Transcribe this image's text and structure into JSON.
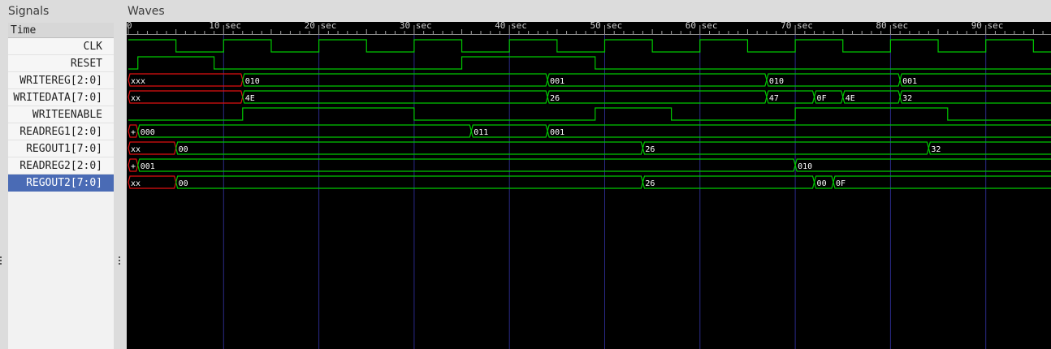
{
  "signals_panel": {
    "title": "Signals",
    "time_header": "Time",
    "signals": [
      {
        "label": "CLK",
        "selected": false
      },
      {
        "label": "RESET",
        "selected": false
      },
      {
        "label": "WRITEREG[2:0]",
        "selected": false
      },
      {
        "label": "WRITEDATA[7:0]",
        "selected": false
      },
      {
        "label": "WRITEENABLE",
        "selected": false
      },
      {
        "label": "READREG1[2:0]",
        "selected": false
      },
      {
        "label": "REGOUT1[7:0]",
        "selected": false
      },
      {
        "label": "READREG2[2:0]",
        "selected": false
      },
      {
        "label": "REGOUT2[7:0]",
        "selected": true
      }
    ]
  },
  "waves_panel": {
    "title": "Waves",
    "time_axis": {
      "unit": "sec",
      "tick_labels": [
        "0",
        "10 sec",
        "20 sec",
        "30 sec",
        "40 sec",
        "50 sec",
        "60 sec",
        "70 sec",
        "80 sec",
        "90 sec"
      ],
      "major_ticks_sec": [
        0,
        10,
        20,
        30,
        40,
        50,
        60,
        70,
        80,
        90
      ],
      "visible_end_sec": 96.3
    },
    "colors": {
      "background": "#000000",
      "trace": "#00c800",
      "unknown": "#e01010",
      "grid": "#2a2a88",
      "text": "#ffffff"
    },
    "traces": [
      {
        "name": "CLK",
        "kind": "bit",
        "changes": [
          [
            0,
            1
          ],
          [
            5,
            0
          ],
          [
            10,
            1
          ],
          [
            15,
            0
          ],
          [
            20,
            1
          ],
          [
            25,
            0
          ],
          [
            30,
            1
          ],
          [
            35,
            0
          ],
          [
            40,
            1
          ],
          [
            45,
            0
          ],
          [
            50,
            1
          ],
          [
            55,
            0
          ],
          [
            60,
            1
          ],
          [
            65,
            0
          ],
          [
            70,
            1
          ],
          [
            75,
            0
          ],
          [
            80,
            1
          ],
          [
            85,
            0
          ],
          [
            90,
            1
          ],
          [
            95,
            0
          ]
        ]
      },
      {
        "name": "RESET",
        "kind": "bit",
        "changes": [
          [
            0,
            0
          ],
          [
            1,
            1
          ],
          [
            9,
            0
          ],
          [
            35,
            1
          ],
          [
            49,
            0
          ]
        ]
      },
      {
        "name": "WRITEREG[2:0]",
        "kind": "bus",
        "segments": [
          [
            0,
            12,
            "xxx",
            true
          ],
          [
            12,
            44,
            "010",
            false
          ],
          [
            44,
            67,
            "001",
            false
          ],
          [
            67,
            81,
            "010",
            false
          ],
          [
            81,
            null,
            "001",
            false
          ]
        ]
      },
      {
        "name": "WRITEDATA[7:0]",
        "kind": "bus",
        "segments": [
          [
            0,
            12,
            "xx",
            true
          ],
          [
            12,
            44,
            "4E",
            false
          ],
          [
            44,
            67,
            "26",
            false
          ],
          [
            67,
            72,
            "47",
            false
          ],
          [
            72,
            75,
            "0F",
            false
          ],
          [
            75,
            81,
            "4E",
            false
          ],
          [
            81,
            null,
            "32",
            false
          ]
        ]
      },
      {
        "name": "WRITEENABLE",
        "kind": "bit",
        "changes": [
          [
            0,
            0
          ],
          [
            12,
            1
          ],
          [
            30,
            0
          ],
          [
            49,
            1
          ],
          [
            57,
            0
          ],
          [
            70,
            1
          ],
          [
            86,
            0
          ]
        ]
      },
      {
        "name": "READREG1[2:0]",
        "kind": "bus",
        "segments": [
          [
            0,
            1,
            "+",
            true
          ],
          [
            1,
            36,
            "000",
            false
          ],
          [
            36,
            44,
            "011",
            false
          ],
          [
            44,
            null,
            "001",
            false
          ]
        ]
      },
      {
        "name": "REGOUT1[7:0]",
        "kind": "bus",
        "segments": [
          [
            0,
            5,
            "xx",
            true
          ],
          [
            5,
            54,
            "00",
            false
          ],
          [
            54,
            84,
            "26",
            false
          ],
          [
            84,
            null,
            "32",
            false
          ]
        ]
      },
      {
        "name": "READREG2[2:0]",
        "kind": "bus",
        "segments": [
          [
            0,
            1,
            "+",
            true
          ],
          [
            1,
            70,
            "001",
            false
          ],
          [
            70,
            null,
            "010",
            false
          ]
        ]
      },
      {
        "name": "REGOUT2[7:0]",
        "kind": "bus",
        "segments": [
          [
            0,
            5,
            "xx",
            true
          ],
          [
            5,
            54,
            "00",
            false
          ],
          [
            54,
            72,
            "26",
            false
          ],
          [
            72,
            74,
            "00",
            false
          ],
          [
            74,
            null,
            "0F",
            false
          ]
        ]
      }
    ]
  }
}
